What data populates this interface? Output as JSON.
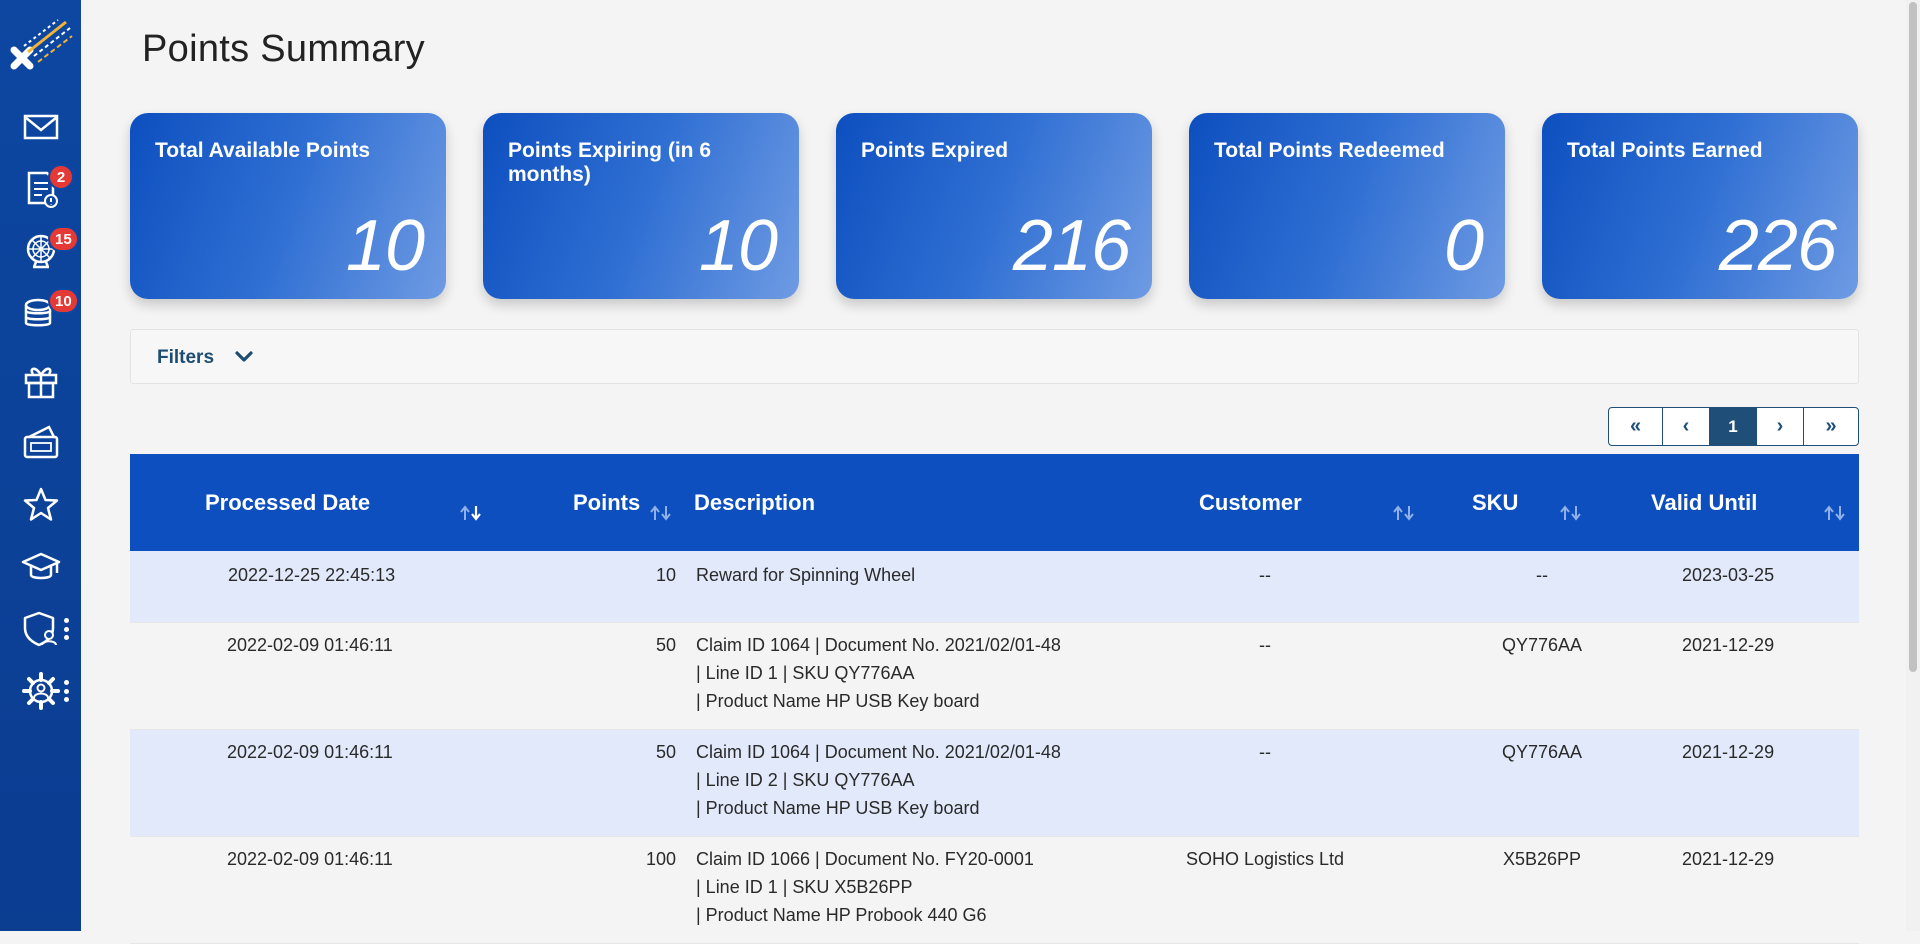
{
  "page": {
    "title": "Points Summary"
  },
  "sidebar": {
    "badges": {
      "claims": "2",
      "wheel": "15",
      "coins": "10"
    }
  },
  "cards": [
    {
      "label": "Total Available Points",
      "value": "10"
    },
    {
      "label": "Points Expiring (in 6 months)",
      "value": "10"
    },
    {
      "label": "Points Expired",
      "value": "216"
    },
    {
      "label": "Total Points Redeemed",
      "value": "0"
    },
    {
      "label": "Total Points Earned",
      "value": "226"
    }
  ],
  "filters": {
    "label": "Filters"
  },
  "pagination": {
    "first": "«",
    "prev": "‹",
    "current": "1",
    "next": "›",
    "last": "»"
  },
  "table": {
    "columns": {
      "processed_date": "Processed Date",
      "points": "Points",
      "description": "Description",
      "customer": "Customer",
      "sku": "SKU",
      "valid_until": "Valid Until"
    },
    "rows": [
      {
        "processed_date": "2022-12-25 22:45:13",
        "points": "10",
        "description_lines": [
          "Reward for Spinning Wheel"
        ],
        "customer": "--",
        "sku": "--",
        "valid_until": "2023-03-25"
      },
      {
        "processed_date": "2022-02-09 01:46:11",
        "points": "50",
        "description_lines": [
          "Claim ID 1064 | Document No. 2021/02/01-48",
          "| Line ID 1 | SKU QY776AA",
          "| Product Name HP USB Key board"
        ],
        "customer": "--",
        "sku": "QY776AA",
        "valid_until": "2021-12-29"
      },
      {
        "processed_date": "2022-02-09 01:46:11",
        "points": "50",
        "description_lines": [
          "Claim ID 1064 | Document No. 2021/02/01-48",
          "| Line ID 2 | SKU QY776AA",
          "| Product Name HP USB Key board"
        ],
        "customer": "--",
        "sku": "QY776AA",
        "valid_until": "2021-12-29"
      },
      {
        "processed_date": "2022-02-09 01:46:11",
        "points": "100",
        "description_lines": [
          "Claim ID 1066 | Document No. FY20-0001",
          "| Line ID 1 | SKU X5B26PP",
          "| Product Name HP Probook 440 G6"
        ],
        "customer": "SOHO Logistics Ltd",
        "sku": "X5B26PP",
        "valid_until": "2021-12-29"
      }
    ]
  }
}
